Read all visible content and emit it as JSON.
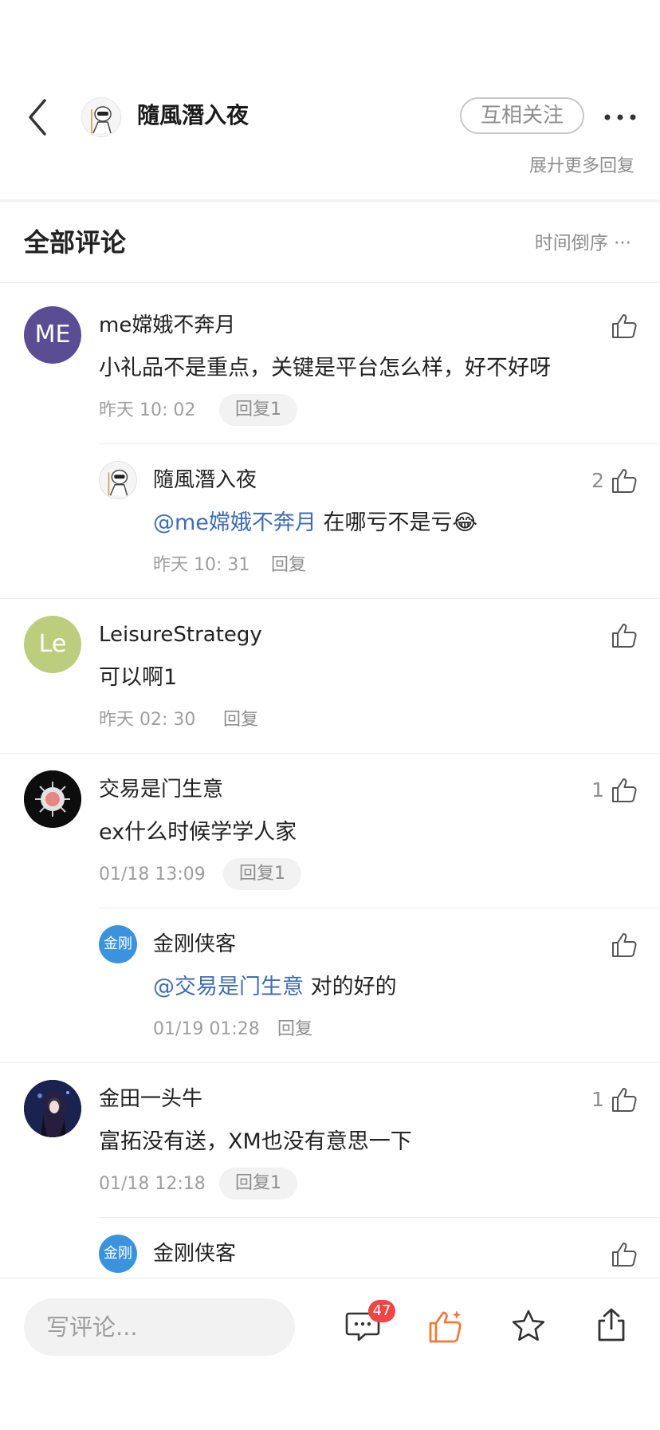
{
  "header": {
    "author_name": "隨風潛入夜",
    "follow_label": "互相关注",
    "expand_more": "展廾更多回复"
  },
  "comments_section": {
    "title": "全部评论",
    "sort_label": "时间倒序"
  },
  "comments": [
    {
      "avatar_text": "ME",
      "avatar_color": "#5a4d93",
      "name": "me嫦娥不奔月",
      "text": "小礼品不是重点，关键是平台怎么样，好不好呀",
      "time": "昨天 10: 02",
      "reply_label": "回复1",
      "likes": ""
    },
    {
      "avatar_text": "Le",
      "avatar_color": "#bccd7e",
      "name": "LeisureStrategy",
      "text": "可以啊1",
      "time": "昨天 02: 30",
      "reply_label": "回复",
      "likes": ""
    },
    {
      "avatar_text": "",
      "avatar_color": "#111111",
      "name": "交易是门生意",
      "text": "ex什么时候学学人家",
      "time": "01/18 13:09",
      "reply_label": "回复1",
      "likes": "1"
    },
    {
      "avatar_text": "",
      "avatar_color": "#1f2a5a",
      "name": "金田一头牛",
      "text": "富拓没有送，XM也没有意思一下",
      "time": "01/18 12:18",
      "reply_label": "回复1",
      "likes": "1"
    }
  ],
  "replies": [
    {
      "name": "隨風潛入夜",
      "mention": "@me嫦娥不奔月",
      "text": " 在哪亏不是亏😂",
      "time": "昨天 10: 31",
      "reply_label": "回复",
      "likes": "2"
    },
    {
      "avatar_text": "金刚",
      "avatar_color": "#3b93de",
      "name": "金刚侠客",
      "mention": "@交易是门生意",
      "text": " 对的好的",
      "time": "01/19 01:28",
      "reply_label": "回复",
      "likes": ""
    },
    {
      "avatar_text": "金刚",
      "avatar_color": "#3b93de",
      "name": "金刚侠客",
      "likes": ""
    }
  ],
  "bottom_bar": {
    "input_placeholder": "写评论...",
    "comment_count": "47",
    "like_color": "#f07a3a"
  }
}
